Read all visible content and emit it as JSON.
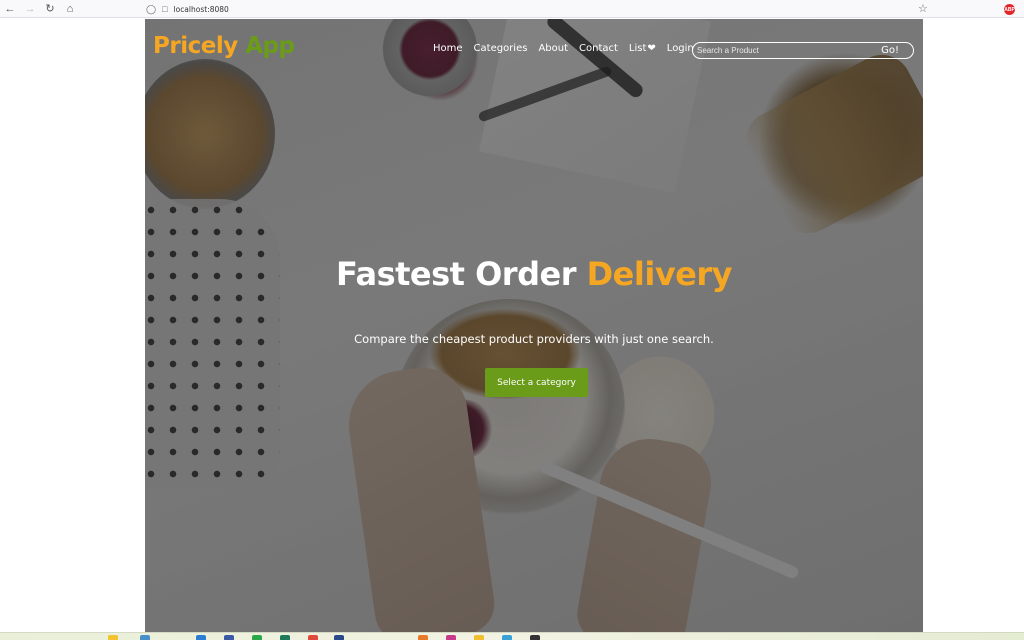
{
  "browser": {
    "url": "localhost:8080",
    "back_icon": "arrow-left-icon",
    "forward_icon": "arrow-right-icon",
    "reload_icon": "reload-icon",
    "home_icon": "home-icon",
    "extension_badge": "ABP"
  },
  "site": {
    "brand_part1": "Pricely",
    "brand_part2": "App",
    "nav": {
      "home": "Home",
      "categories": "Categories",
      "about": "About",
      "contact": "Contact",
      "list": "List",
      "login": "Login"
    },
    "search": {
      "placeholder": "Search a Product",
      "button": "Go!"
    }
  },
  "hero": {
    "title_main": "Fastest Order",
    "title_accent": "Delivery",
    "subtitle": "Compare the cheapest product providers with just one search.",
    "cta": "Select a category"
  },
  "colors": {
    "brand_orange": "#f5a623",
    "brand_green": "#6a9c1a"
  }
}
